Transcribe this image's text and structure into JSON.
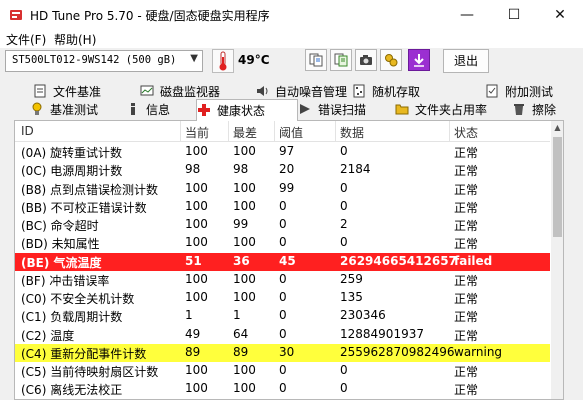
{
  "window": {
    "title": "HD Tune Pro 5.70 - 硬盘/固态硬盘实用程序",
    "minimize": "—",
    "maximize": "☐",
    "close": "✕"
  },
  "menu": {
    "file": "文件(F)",
    "help": "帮助(H)"
  },
  "toolbar": {
    "drive": "ST500LT012-9WS142 (500 gB)",
    "temperature": "49°C",
    "exit": "退出"
  },
  "tabs_row1": [
    {
      "label": "文件基准"
    },
    {
      "label": "磁盘监视器"
    },
    {
      "label": "自动噪音管理"
    },
    {
      "label": "随机存取"
    },
    {
      "label": "附加测试"
    }
  ],
  "tabs_row2": [
    {
      "label": "基准测试"
    },
    {
      "label": "信息"
    },
    {
      "label": "健康状态"
    },
    {
      "label": "错误扫描"
    },
    {
      "label": "文件夹占用率"
    },
    {
      "label": "擦除"
    }
  ],
  "columns": {
    "id": "ID",
    "current": "当前",
    "worst": "最差",
    "threshold": "阈值",
    "data": "数据",
    "status": "状态"
  },
  "rows": [
    {
      "id": "(0A) 旋转重试计数",
      "current": "100",
      "worst": "100",
      "threshold": "97",
      "data": "0",
      "status": "正常"
    },
    {
      "id": "(0C) 电源周期计数",
      "current": "98",
      "worst": "98",
      "threshold": "20",
      "data": "2184",
      "status": "正常"
    },
    {
      "id": "(B8) 点到点错误检测计数",
      "current": "100",
      "worst": "100",
      "threshold": "99",
      "data": "0",
      "status": "正常"
    },
    {
      "id": "(BB) 不可校正错误计数",
      "current": "100",
      "worst": "100",
      "threshold": "0",
      "data": "0",
      "status": "正常"
    },
    {
      "id": "(BC) 命令超时",
      "current": "100",
      "worst": "99",
      "threshold": "0",
      "data": "2",
      "status": "正常"
    },
    {
      "id": "(BD) 未知属性",
      "current": "100",
      "worst": "100",
      "threshold": "0",
      "data": "0",
      "status": "正常"
    },
    {
      "id": "(BE) 气流温度",
      "current": "51",
      "worst": "36",
      "threshold": "45",
      "data": "26294665412657",
      "status": "failed"
    },
    {
      "id": "(BF) 冲击错误率",
      "current": "100",
      "worst": "100",
      "threshold": "0",
      "data": "259",
      "status": "正常"
    },
    {
      "id": "(C0) 不安全关机计数",
      "current": "100",
      "worst": "100",
      "threshold": "0",
      "data": "135",
      "status": "正常"
    },
    {
      "id": "(C1) 负载周期计数",
      "current": "1",
      "worst": "1",
      "threshold": "0",
      "data": "230346",
      "status": "正常"
    },
    {
      "id": "(C2) 温度",
      "current": "49",
      "worst": "64",
      "threshold": "0",
      "data": "12884901937",
      "status": "正常"
    },
    {
      "id": "(C4) 重新分配事件计数",
      "current": "89",
      "worst": "89",
      "threshold": "30",
      "data": "255962870982496",
      "status": "warning"
    },
    {
      "id": "(C5) 当前待映射扇区计数",
      "current": "100",
      "worst": "100",
      "threshold": "0",
      "data": "0",
      "status": "正常"
    },
    {
      "id": "(C6) 离线无法校正",
      "current": "100",
      "worst": "100",
      "threshold": "0",
      "data": "0",
      "status": "正常"
    }
  ],
  "colors": {
    "failed_row": "#ff2020",
    "warning_row": "#ffff3c"
  }
}
